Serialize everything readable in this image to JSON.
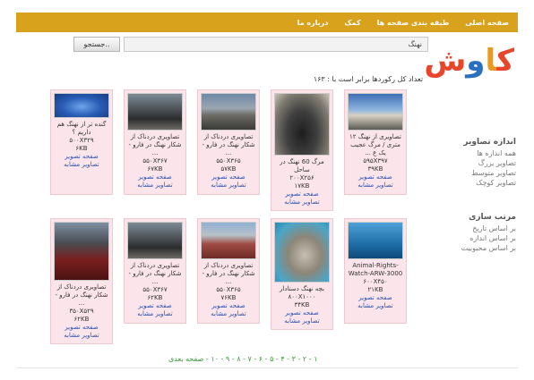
{
  "nav": {
    "items": [
      "صفحه اصلی",
      "طبقه بندی صفحه ها",
      "کمک",
      "درباره ما"
    ]
  },
  "logo": {
    "text": "کاوش"
  },
  "search": {
    "value": "نهنگ",
    "button_label": "جستجو.."
  },
  "results": {
    "count_text": "تعداد کل رکوردها برابر است با : ۱۶۳"
  },
  "sidebar": {
    "size_title": "اندازه تصاویر",
    "size_items": [
      "همه اندازه ها",
      "تصاویر بزرگ",
      "تصاویر متوسط",
      "تصاویر کوچک"
    ],
    "sort_title": "مرتب سازی",
    "sort_items": [
      "بر اساس تاریخ",
      "بر اساس اندازه",
      "بر اساس محبوبیت"
    ]
  },
  "links": {
    "page": "صفحه تصویر",
    "similar": "تصاویر مشابه"
  },
  "cards_row1": [
    {
      "title": "تصاویری از نهنگ ۱۲ متری / مرگ عجیب یک ع ...",
      "dims": "۵۹۵X۳۹۷",
      "size": "۳۹KB"
    },
    {
      "title": "مرگ 60 نهنگ در ساحل",
      "dims": "۲۰۰X۲۵۶",
      "size": "۱۷KB"
    },
    {
      "title": "تصاویری دردناک از شکار نهنگ در فارو - ...",
      "dims": "۵۵۰X۳۶۵",
      "size": "۵۷KB"
    },
    {
      "title": "تصاویری دردناک از شکار نهنگ در فارو - ...",
      "dims": "۵۵۰X۳۶۷",
      "size": "۶۷KB"
    },
    {
      "title": "گنده تر از نهنگ هم داریم ؟",
      "dims": "۵۰۰X۳۲۹",
      "size": "۶KB"
    }
  ],
  "cards_row2": [
    {
      "title": "Animal-Rights-Watch-ARW-3000",
      "dims": "۶۰۰X۴۵۰",
      "size": "۲۱KB"
    },
    {
      "title": "بچه نهنگ دستادار",
      "dims": "۸۰۰X۱۰۰۰",
      "size": "۳۴KB"
    },
    {
      "title": "تصاویری دردناک از شکار نهنگ در فارو - ...",
      "dims": "۵۵۰X۳۶۵",
      "size": "۷۶KB"
    },
    {
      "title": "تصاویری دردناک از شکار نهنگ در فارو - ...",
      "dims": "۵۵۰X۳۶۷",
      "size": "۶۲KB"
    },
    {
      "title": "تصاویری دردناک از شکار نهنگ در فارو - ...",
      "dims": "۳۵۰X۵۲۹",
      "size": "۶۲KB"
    }
  ],
  "pagination": {
    "text": "۱ - ۲ - ۳ - ۴ - ۵ - ۶ - ۷ - ۸ - ۹ - ۱۰ - صفحه بعدی"
  }
}
